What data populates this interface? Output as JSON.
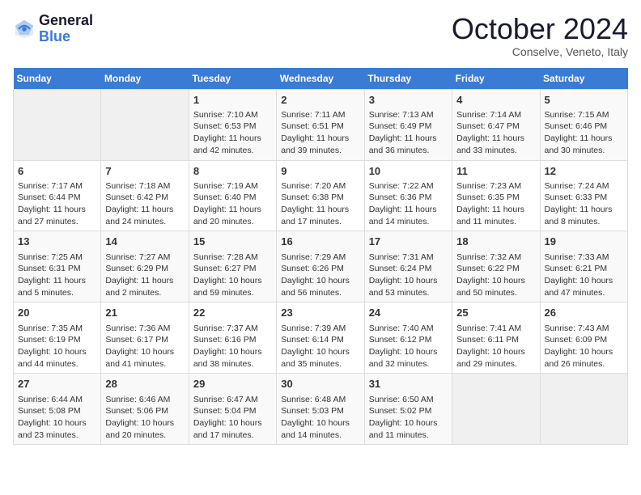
{
  "logo": {
    "line1": "General",
    "line2": "Blue"
  },
  "title": "October 2024",
  "location": "Conselve, Veneto, Italy",
  "headers": [
    "Sunday",
    "Monday",
    "Tuesday",
    "Wednesday",
    "Thursday",
    "Friday",
    "Saturday"
  ],
  "rows": [
    [
      {
        "day": "",
        "info": ""
      },
      {
        "day": "",
        "info": ""
      },
      {
        "day": "1",
        "info": "Sunrise: 7:10 AM\nSunset: 6:53 PM\nDaylight: 11 hours and 42 minutes."
      },
      {
        "day": "2",
        "info": "Sunrise: 7:11 AM\nSunset: 6:51 PM\nDaylight: 11 hours and 39 minutes."
      },
      {
        "day": "3",
        "info": "Sunrise: 7:13 AM\nSunset: 6:49 PM\nDaylight: 11 hours and 36 minutes."
      },
      {
        "day": "4",
        "info": "Sunrise: 7:14 AM\nSunset: 6:47 PM\nDaylight: 11 hours and 33 minutes."
      },
      {
        "day": "5",
        "info": "Sunrise: 7:15 AM\nSunset: 6:46 PM\nDaylight: 11 hours and 30 minutes."
      }
    ],
    [
      {
        "day": "6",
        "info": "Sunrise: 7:17 AM\nSunset: 6:44 PM\nDaylight: 11 hours and 27 minutes."
      },
      {
        "day": "7",
        "info": "Sunrise: 7:18 AM\nSunset: 6:42 PM\nDaylight: 11 hours and 24 minutes."
      },
      {
        "day": "8",
        "info": "Sunrise: 7:19 AM\nSunset: 6:40 PM\nDaylight: 11 hours and 20 minutes."
      },
      {
        "day": "9",
        "info": "Sunrise: 7:20 AM\nSunset: 6:38 PM\nDaylight: 11 hours and 17 minutes."
      },
      {
        "day": "10",
        "info": "Sunrise: 7:22 AM\nSunset: 6:36 PM\nDaylight: 11 hours and 14 minutes."
      },
      {
        "day": "11",
        "info": "Sunrise: 7:23 AM\nSunset: 6:35 PM\nDaylight: 11 hours and 11 minutes."
      },
      {
        "day": "12",
        "info": "Sunrise: 7:24 AM\nSunset: 6:33 PM\nDaylight: 11 hours and 8 minutes."
      }
    ],
    [
      {
        "day": "13",
        "info": "Sunrise: 7:25 AM\nSunset: 6:31 PM\nDaylight: 11 hours and 5 minutes."
      },
      {
        "day": "14",
        "info": "Sunrise: 7:27 AM\nSunset: 6:29 PM\nDaylight: 11 hours and 2 minutes."
      },
      {
        "day": "15",
        "info": "Sunrise: 7:28 AM\nSunset: 6:27 PM\nDaylight: 10 hours and 59 minutes."
      },
      {
        "day": "16",
        "info": "Sunrise: 7:29 AM\nSunset: 6:26 PM\nDaylight: 10 hours and 56 minutes."
      },
      {
        "day": "17",
        "info": "Sunrise: 7:31 AM\nSunset: 6:24 PM\nDaylight: 10 hours and 53 minutes."
      },
      {
        "day": "18",
        "info": "Sunrise: 7:32 AM\nSunset: 6:22 PM\nDaylight: 10 hours and 50 minutes."
      },
      {
        "day": "19",
        "info": "Sunrise: 7:33 AM\nSunset: 6:21 PM\nDaylight: 10 hours and 47 minutes."
      }
    ],
    [
      {
        "day": "20",
        "info": "Sunrise: 7:35 AM\nSunset: 6:19 PM\nDaylight: 10 hours and 44 minutes."
      },
      {
        "day": "21",
        "info": "Sunrise: 7:36 AM\nSunset: 6:17 PM\nDaylight: 10 hours and 41 minutes."
      },
      {
        "day": "22",
        "info": "Sunrise: 7:37 AM\nSunset: 6:16 PM\nDaylight: 10 hours and 38 minutes."
      },
      {
        "day": "23",
        "info": "Sunrise: 7:39 AM\nSunset: 6:14 PM\nDaylight: 10 hours and 35 minutes."
      },
      {
        "day": "24",
        "info": "Sunrise: 7:40 AM\nSunset: 6:12 PM\nDaylight: 10 hours and 32 minutes."
      },
      {
        "day": "25",
        "info": "Sunrise: 7:41 AM\nSunset: 6:11 PM\nDaylight: 10 hours and 29 minutes."
      },
      {
        "day": "26",
        "info": "Sunrise: 7:43 AM\nSunset: 6:09 PM\nDaylight: 10 hours and 26 minutes."
      }
    ],
    [
      {
        "day": "27",
        "info": "Sunrise: 6:44 AM\nSunset: 5:08 PM\nDaylight: 10 hours and 23 minutes."
      },
      {
        "day": "28",
        "info": "Sunrise: 6:46 AM\nSunset: 5:06 PM\nDaylight: 10 hours and 20 minutes."
      },
      {
        "day": "29",
        "info": "Sunrise: 6:47 AM\nSunset: 5:04 PM\nDaylight: 10 hours and 17 minutes."
      },
      {
        "day": "30",
        "info": "Sunrise: 6:48 AM\nSunset: 5:03 PM\nDaylight: 10 hours and 14 minutes."
      },
      {
        "day": "31",
        "info": "Sunrise: 6:50 AM\nSunset: 5:02 PM\nDaylight: 10 hours and 11 minutes."
      },
      {
        "day": "",
        "info": ""
      },
      {
        "day": "",
        "info": ""
      }
    ]
  ]
}
